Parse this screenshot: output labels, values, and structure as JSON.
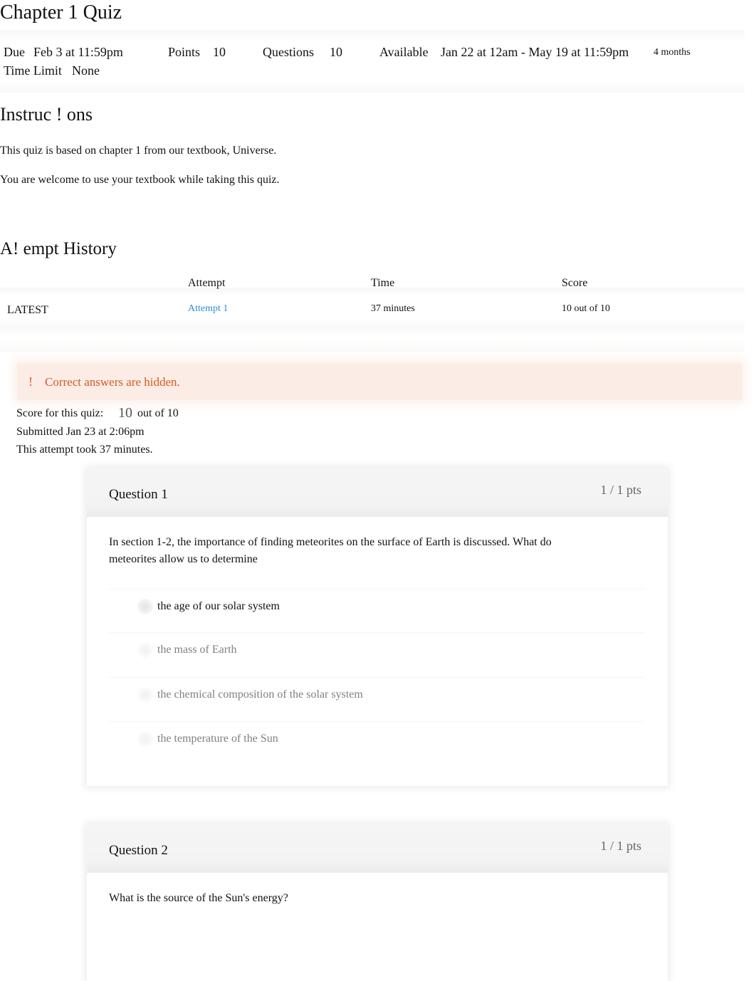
{
  "page": {
    "title": "Chapter 1 Quiz"
  },
  "details": {
    "due_label": "Due",
    "due_value": "Feb 3 at 11:59pm",
    "points_label": "Points",
    "points_value": "10",
    "questions_label": "Questions",
    "questions_value": "10",
    "available_label": "Available",
    "available_value": "Jan 22 at 12am - May 19 at 11:59pm",
    "available_duration": "4 months",
    "time_limit_label": "Time Limit",
    "time_limit_value": "None"
  },
  "instructions": {
    "heading": "Instruc ! ons",
    "paragraphs": [
      "This quiz is based on chapter 1 from our textbook, Universe.",
      "You are welcome to use your textbook while taking this quiz."
    ]
  },
  "attempt_history": {
    "heading": "A! empt History",
    "columns": [
      "",
      "Attempt",
      "Time",
      "Score"
    ],
    "rows": [
      {
        "tag": "LATEST",
        "attempt": "Attempt 1",
        "time": "37 minutes",
        "score": "10 out of 10"
      }
    ]
  },
  "alert": {
    "icon": "warning-icon",
    "text": "Correct answers are hidden.",
    "color": "#d95a22"
  },
  "submission": {
    "score_label": "Score for this quiz:",
    "score_value": "10",
    "score_suffix": "out of 10",
    "submitted": "Submitted Jan 23 at 2:06pm",
    "duration": "This attempt took 37 minutes."
  },
  "questions": [
    {
      "name": "Question 1",
      "points": "1 / 1 pts",
      "text": "In section 1-2, the importance of finding meteorites on the surface of Earth is discussed. What do meteorites allow us to determine",
      "answers": [
        {
          "text": "the age of our solar system",
          "selected": true
        },
        {
          "text": "the mass of Earth",
          "selected": false
        },
        {
          "text": "the chemical composition of the solar system",
          "selected": false
        },
        {
          "text": "the temperature of the Sun",
          "selected": false
        }
      ]
    },
    {
      "name": "Question 2",
      "points": "1 / 1 pts",
      "text": "What is the source of the Sun's energy?"
    }
  ]
}
